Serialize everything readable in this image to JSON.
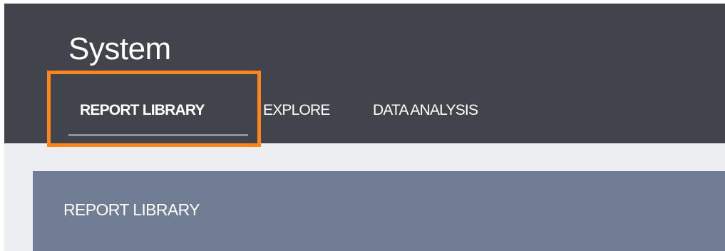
{
  "header": {
    "title": "System",
    "tabs": [
      {
        "label": "REPORT LIBRARY",
        "active": true
      },
      {
        "label": "EXPLORE",
        "active": false
      },
      {
        "label": "DATA ANALYSIS",
        "active": false
      }
    ]
  },
  "panel": {
    "title": "REPORT LIBRARY"
  },
  "colors": {
    "header_bg": "#42444c",
    "page_bg": "#eceef2",
    "panel_bg": "#707d92",
    "highlight": "#ff8419",
    "text": "#ffffff"
  }
}
